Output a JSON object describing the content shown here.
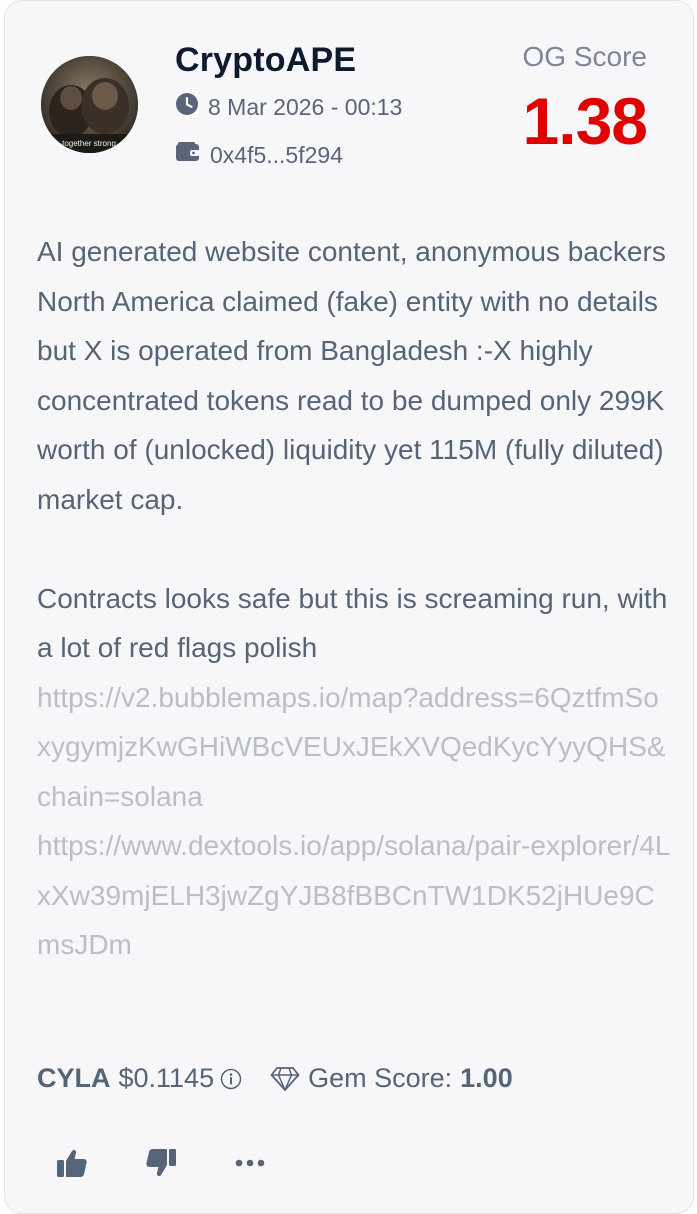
{
  "post": {
    "username": "CryptoAPE",
    "avatar_caption": "together strong",
    "timestamp": "8 Mar 2026 - 00:13",
    "wallet": "0x4f5...5f294",
    "og_score_label": "OG Score",
    "og_score_value": "1.38",
    "paragraph_1": "AI generated website content, anonymous backers North America claimed (fake) entity with no details but X is operated from Bangladesh :-X highly concentrated tokens read to be dumped only 299K worth of (unlocked) liquidity yet 115M (fully diluted) market cap.",
    "paragraph_2": "Contracts looks safe but this is screaming run, with a lot of red flags polish",
    "links": [
      "https://v2.bubblemaps.io/map?address=6QztfmSoxygymjzKwGHiWBcVEUxJEkXVQedKycYyyQHS&chain=solana",
      "https://www.dextools.io/app/solana/pair-explorer/4LxXw39mjELH3jwZgYJB8fBBCnTW1DK52jHUe9CmsJDm"
    ]
  },
  "token": {
    "ticker": "CYLA",
    "price": "$0.1145",
    "gem_label": "Gem Score:",
    "gem_value": "1.00"
  },
  "icons": {
    "time": "clock-icon",
    "wallet": "wallet-icon",
    "info": "info-icon",
    "gem": "diamond-icon",
    "like": "thumbs-up-icon",
    "dislike": "thumbs-down-icon",
    "more": "more-icon"
  },
  "colors": {
    "og_score": "#e00000",
    "body_text": "#566477",
    "link": "#b9bec7",
    "card_background": "#f7f7f9"
  }
}
